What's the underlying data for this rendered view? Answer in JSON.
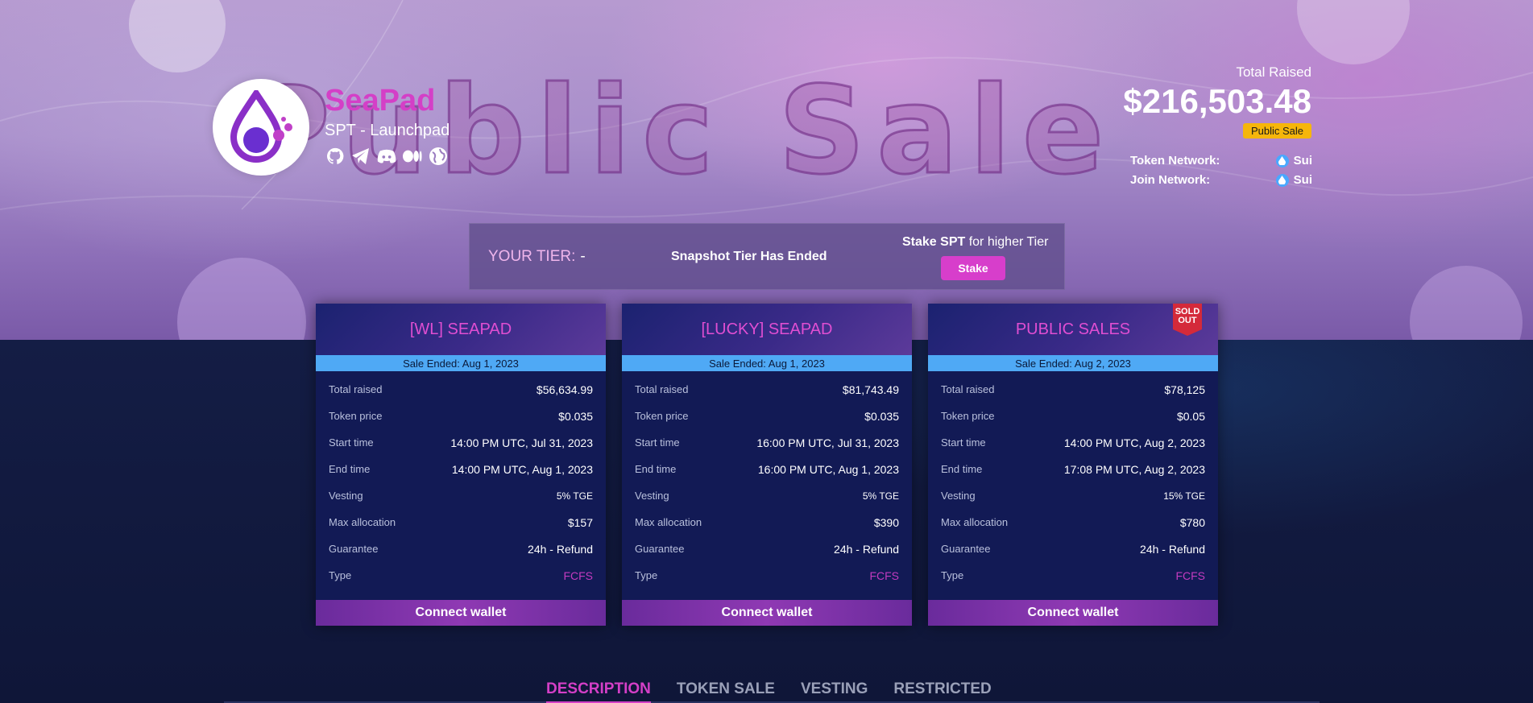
{
  "hero": {
    "background_text": "Public Sale"
  },
  "project": {
    "name": "SeaPad",
    "subtitle": "SPT - Launchpad",
    "socials": [
      "github-icon",
      "telegram-icon",
      "discord-icon",
      "medium-icon",
      "globe-icon"
    ]
  },
  "raised": {
    "label": "Total Raised",
    "value": "$216,503.48",
    "badge": "Public Sale",
    "token_network_label": "Token Network:",
    "token_network_value": "Sui",
    "join_network_label": "Join Network:",
    "join_network_value": "Sui"
  },
  "tier": {
    "label": "YOUR TIER:",
    "value": "-",
    "snapshot": "Snapshot Tier Has Ended",
    "stake_bold": "Stake SPT",
    "stake_rest": " for higher Tier",
    "stake_button": "Stake"
  },
  "pools": [
    {
      "title": "[WL] SEAPAD",
      "date": "Sale Ended: Aug 1, 2023",
      "rows": [
        {
          "k": "Total raised",
          "v": "$56,634.99"
        },
        {
          "k": "Token price",
          "v": "$0.035"
        },
        {
          "k": "Start time",
          "v": "14:00 PM UTC, Jul 31, 2023"
        },
        {
          "k": "End time",
          "v": "14:00 PM UTC, Aug 1, 2023"
        },
        {
          "k": "Vesting",
          "v": "5% TGE"
        },
        {
          "k": "Max allocation",
          "v": "$157"
        },
        {
          "k": "Guarantee",
          "v": "24h - Refund"
        },
        {
          "k": "Type",
          "v": "FCFS"
        }
      ],
      "button": "Connect wallet"
    },
    {
      "title": "[LUCKY] SEAPAD",
      "date": "Sale Ended: Aug 1, 2023",
      "rows": [
        {
          "k": "Total raised",
          "v": "$81,743.49"
        },
        {
          "k": "Token price",
          "v": "$0.035"
        },
        {
          "k": "Start time",
          "v": "16:00 PM UTC, Jul 31, 2023"
        },
        {
          "k": "End time",
          "v": "16:00 PM UTC, Aug 1, 2023"
        },
        {
          "k": "Vesting",
          "v": "5% TGE"
        },
        {
          "k": "Max allocation",
          "v": "$390"
        },
        {
          "k": "Guarantee",
          "v": "24h - Refund"
        },
        {
          "k": "Type",
          "v": "FCFS"
        }
      ],
      "button": "Connect wallet"
    },
    {
      "title": "PUBLIC SALES",
      "sold_out": "SOLD OUT",
      "date": "Sale Ended: Aug 2, 2023",
      "rows": [
        {
          "k": "Total raised",
          "v": "$78,125"
        },
        {
          "k": "Token price",
          "v": "$0.05"
        },
        {
          "k": "Start time",
          "v": "14:00 PM UTC, Aug 2, 2023"
        },
        {
          "k": "End time",
          "v": "17:08 PM UTC, Aug 2, 2023"
        },
        {
          "k": "Vesting",
          "v": "15% TGE"
        },
        {
          "k": "Max allocation",
          "v": "$780"
        },
        {
          "k": "Guarantee",
          "v": "24h - Refund"
        },
        {
          "k": "Type",
          "v": "FCFS"
        }
      ],
      "button": "Connect wallet"
    }
  ],
  "tabs": [
    "DESCRIPTION",
    "TOKEN SALE",
    "VESTING",
    "RESTRICTED"
  ],
  "colors": {
    "accent_pink": "#d43fc7",
    "badge_yellow": "#f6b60b",
    "date_bar_blue": "#4fa9f5",
    "card_bg": "#121a55"
  }
}
